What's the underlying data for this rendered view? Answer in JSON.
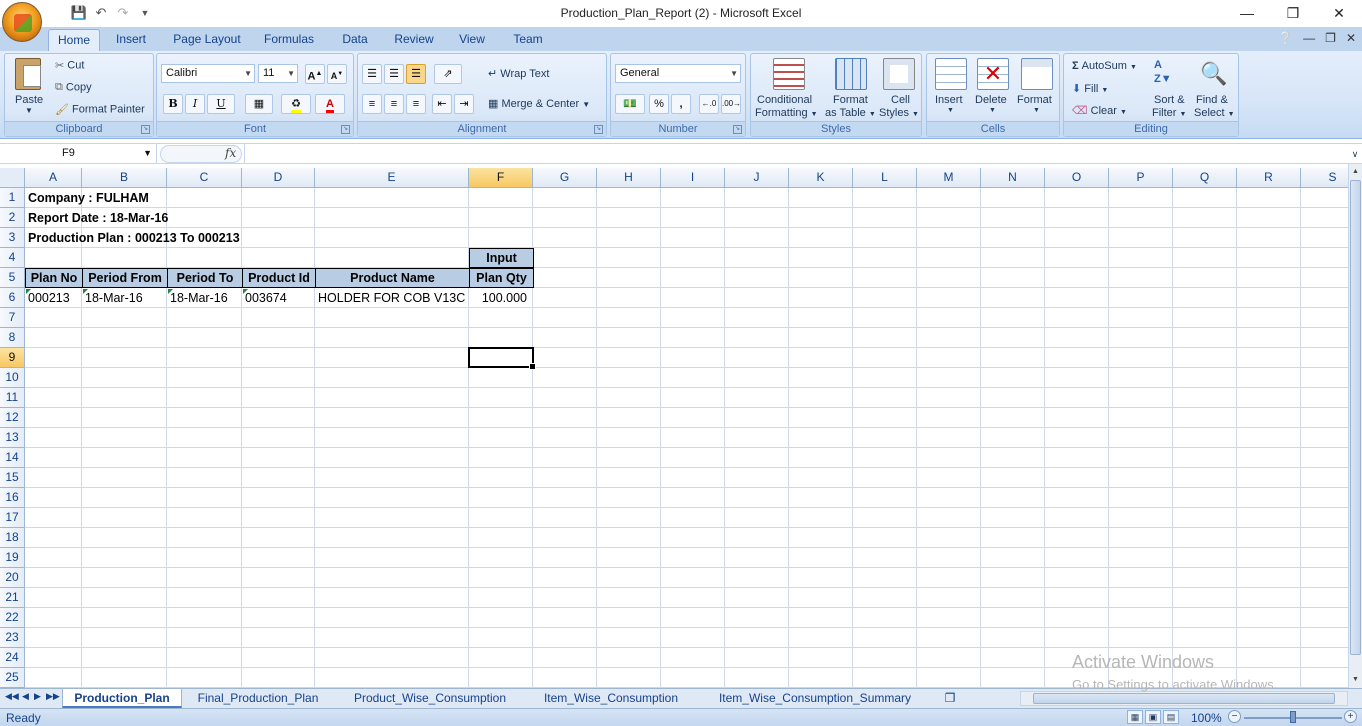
{
  "window": {
    "title": "Production_Plan_Report (2) - Microsoft Excel"
  },
  "ribbon_tabs": [
    "Home",
    "Insert",
    "Page Layout",
    "Formulas",
    "Data",
    "Review",
    "View",
    "Team"
  ],
  "clipboard": {
    "paste": "Paste",
    "cut": "Cut",
    "copy": "Copy",
    "format_painter": "Format Painter",
    "label": "Clipboard"
  },
  "font": {
    "name": "Calibri",
    "size": "11",
    "label": "Font",
    "bold": "B",
    "italic": "I",
    "underline": "U",
    "grow": "A",
    "shrink": "A",
    "fontcolor": "A"
  },
  "alignment": {
    "wrap_text": "Wrap Text",
    "merge_center": "Merge & Center",
    "label": "Alignment"
  },
  "number": {
    "format": "General",
    "percent": "%",
    "comma": ",",
    "inc": ".0→.00",
    "dec": ".00→.0",
    "label": "Number"
  },
  "styles": {
    "cond_fmt_1": "Conditional",
    "cond_fmt_2": "Formatting",
    "fmt_table_1": "Format",
    "fmt_table_2": "as Table",
    "cell_styles_1": "Cell",
    "cell_styles_2": "Styles",
    "label": "Styles"
  },
  "cells_group": {
    "insert": "Insert",
    "delete": "Delete",
    "format": "Format",
    "label": "Cells"
  },
  "editing": {
    "autosum": "AutoSum",
    "fill": "Fill",
    "clear": "Clear",
    "sort_1": "Sort &",
    "sort_2": "Filter",
    "find_1": "Find &",
    "find_2": "Select",
    "label": "Editing"
  },
  "formula_bar": {
    "name_box": "F9",
    "fx": "fx",
    "content": ""
  },
  "columns": [
    "A",
    "B",
    "C",
    "D",
    "E",
    "F",
    "G",
    "H",
    "I",
    "J",
    "K",
    "L",
    "M",
    "N",
    "O",
    "P",
    "Q",
    "R",
    "S"
  ],
  "rows": [
    "1",
    "2",
    "3",
    "4",
    "5",
    "6",
    "7",
    "8",
    "9",
    "10",
    "11",
    "12",
    "13",
    "14",
    "15",
    "16",
    "17",
    "18",
    "19",
    "20",
    "21",
    "22",
    "23",
    "24",
    "25"
  ],
  "sheet": {
    "company": "Company : FULHAM",
    "report_date": "Report Date : 18-Mar-16",
    "plan_range": "Production Plan : 000213 To 000213",
    "headers": {
      "input": "Input",
      "plan_no": "Plan No",
      "period_from": "Period From",
      "period_to": "Period To",
      "product_id": "Product Id",
      "product_name": "Product Name",
      "plan_qty": "Plan Qty"
    },
    "row6": {
      "plan_no": "000213",
      "period_from": "18-Mar-16",
      "period_to": "18-Mar-16",
      "product_id": "003674",
      "product_name": "HOLDER FOR COB V13C",
      "plan_qty": "100.000"
    }
  },
  "sheet_tabs": [
    "Production_Plan",
    "Final_Production_Plan",
    "Product_Wise_Consumption",
    "Item_Wise_Consumption",
    "Item_Wise_Consumption_Summary"
  ],
  "status": {
    "ready": "Ready",
    "zoom": "100%"
  },
  "watermark": {
    "line1": "Activate Windows",
    "line2": "Go to Settings to activate Windows."
  }
}
